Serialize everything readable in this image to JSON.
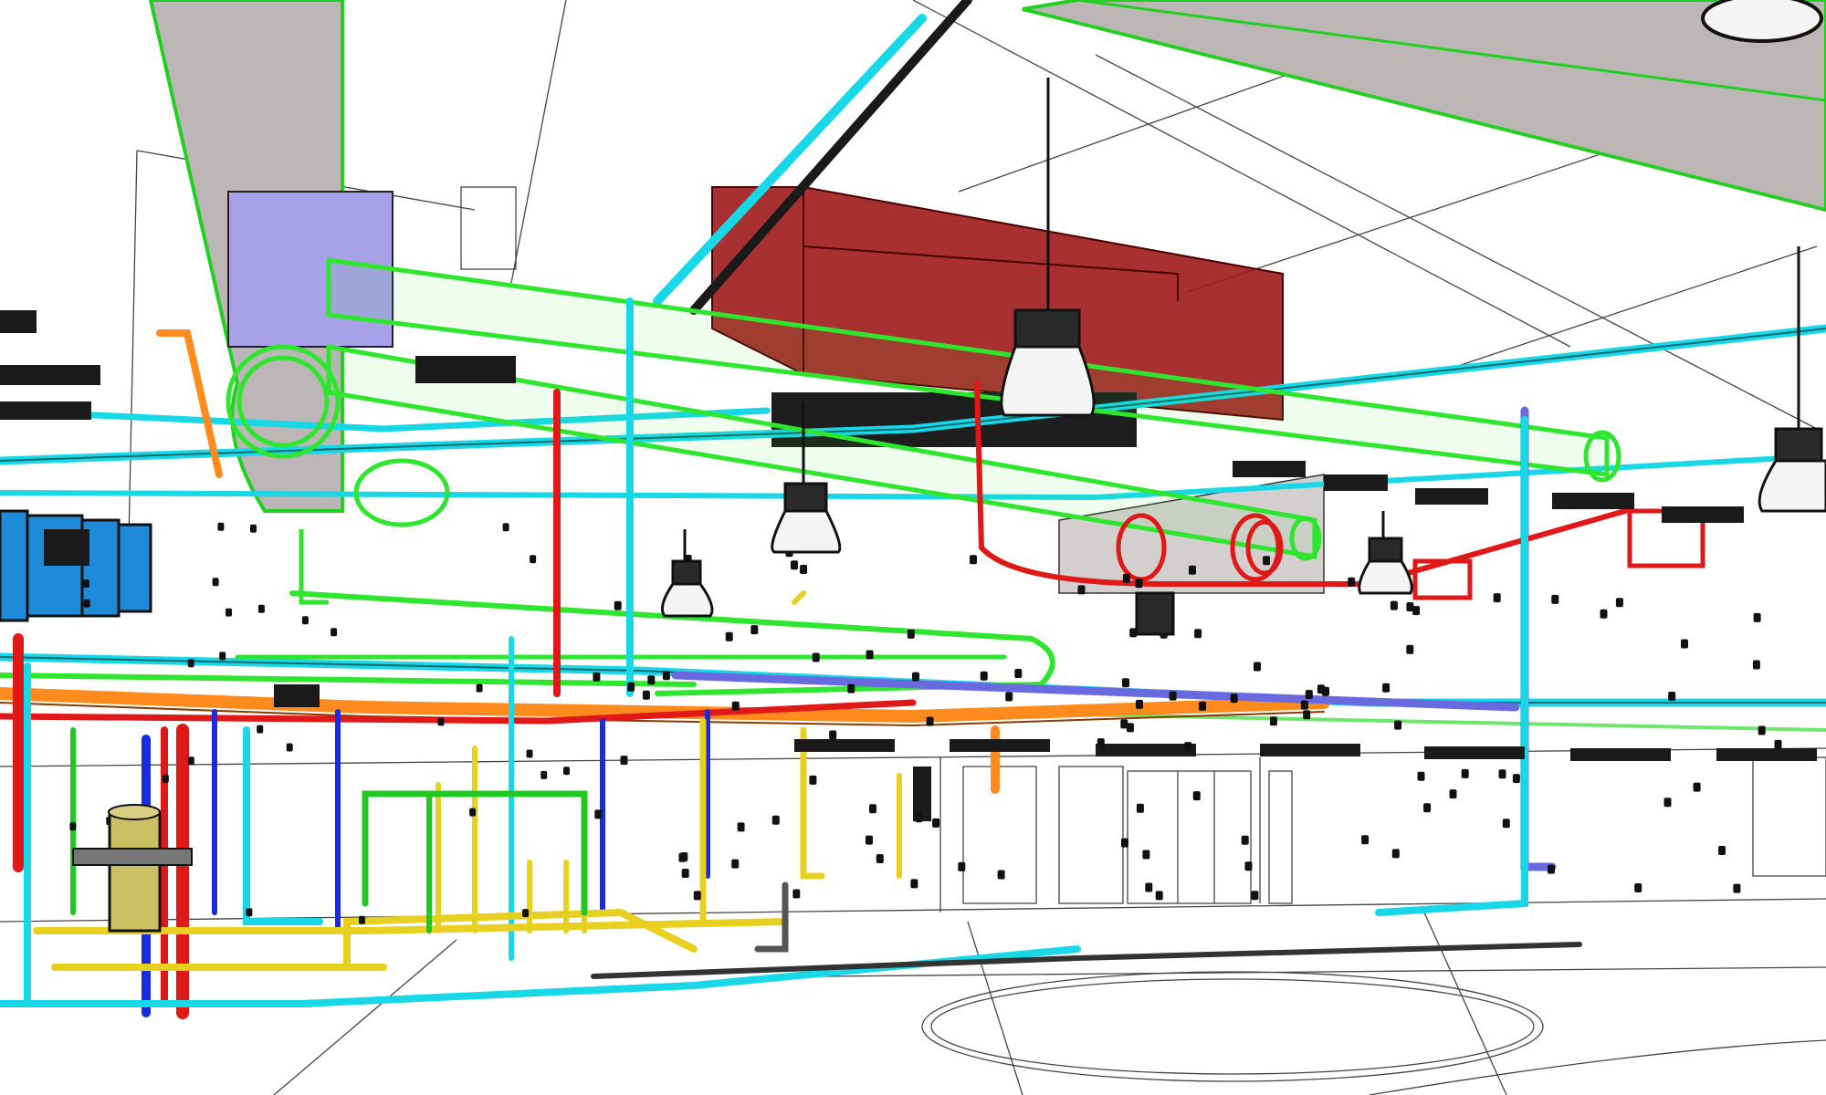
{
  "scene": {
    "kind": "bim-mep-coordination-3d-view",
    "background": "#ffffff",
    "linework": "#3a3a3a"
  },
  "systems": [
    {
      "id": "supply-duct",
      "color": "#2ee62e"
    },
    {
      "id": "chilled-water",
      "color": "#18d8e8"
    },
    {
      "id": "heating-water",
      "color": "#e01818"
    },
    {
      "id": "domestic-water",
      "color": "#e8d020"
    },
    {
      "id": "gas",
      "color": "#ff8a1e"
    },
    {
      "id": "drain",
      "color": "#1a2adc"
    },
    {
      "id": "condensate",
      "color": "#6a6ae0"
    },
    {
      "id": "sprinkler",
      "color": "#22c822"
    }
  ],
  "equipment": [
    {
      "id": "air-handling-unit",
      "color": "#a01a1a"
    },
    {
      "id": "electrical-panels",
      "color": "#1e8ad8"
    },
    {
      "id": "water-heater-tank",
      "color": "#cbbf64"
    },
    {
      "id": "main-return-duct",
      "color": "#bdb6b6"
    },
    {
      "id": "pendant-light",
      "color": "#2a2a2a"
    }
  ]
}
